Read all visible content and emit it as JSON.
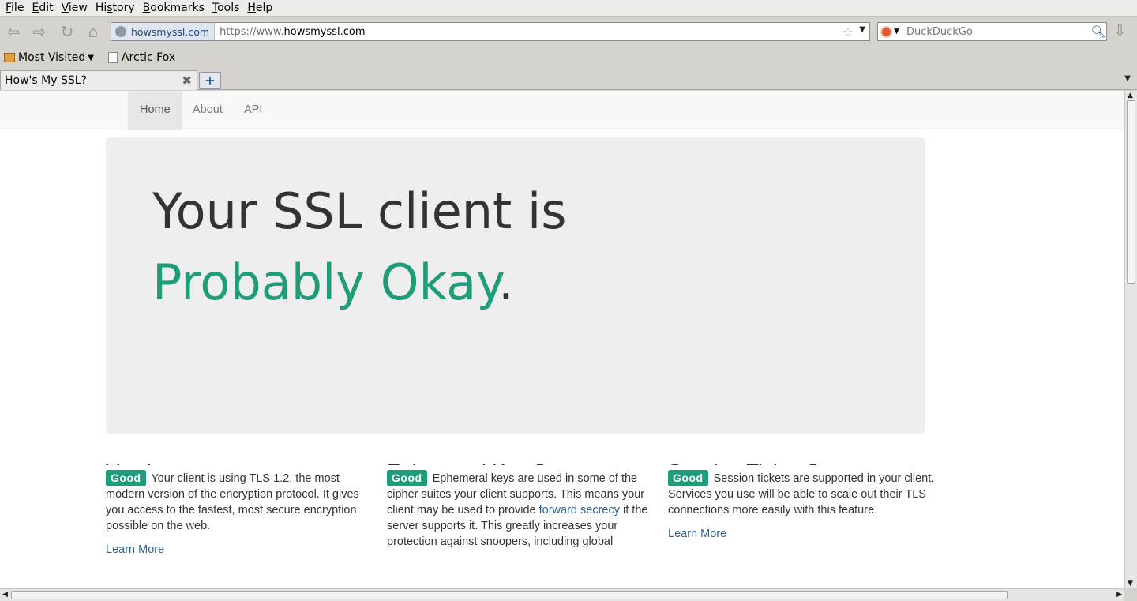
{
  "menu": [
    "File",
    "Edit",
    "View",
    "History",
    "Bookmarks",
    "Tools",
    "Help"
  ],
  "menu_mnemonics": [
    "F",
    "E",
    "V",
    "s",
    "B",
    "T",
    "H"
  ],
  "navbar": {
    "identity_label": "howsmyssl.com",
    "url_prefix": "https://www.",
    "url_domain": "howsmyssl.com",
    "search_placeholder": "DuckDuckGo"
  },
  "bookmarks": [
    {
      "label": "Most Visited",
      "icon": "folder-icon"
    },
    {
      "label": "Arctic Fox",
      "icon": "page-icon"
    }
  ],
  "tab": {
    "title": "How's My SSL?"
  },
  "site": {
    "nav": [
      "Home",
      "About",
      "API"
    ],
    "active_nav": "Home",
    "headline_line1": "Your SSL client is",
    "rating": "Probably Okay",
    "rating_suffix": ".",
    "rating_color": "#1f9c7a",
    "columns": [
      {
        "heading": "Version",
        "badge": "Good",
        "text": "Your client is using TLS 1.2, the most modern version of the encryption protocol. It gives you access to the fastest, most secure encryption possible on the web.",
        "link": "",
        "text_after": "",
        "learn_more": "Learn More"
      },
      {
        "heading": "Ephemeral Key Support",
        "badge": "Good",
        "text": "Ephemeral keys are used in some of the cipher suites your client supports. This means your client may be used to provide ",
        "link": "forward secrecy",
        "text_after": " if the server supports it. This greatly increases your protection against snoopers, including global",
        "learn_more": ""
      },
      {
        "heading": "Session Ticket Support",
        "badge": "Good",
        "text": "Session tickets are supported in your client. Services you use will be able to scale out their TLS connections more easily with this feature.",
        "link": "",
        "text_after": "",
        "learn_more": "Learn More"
      }
    ]
  }
}
